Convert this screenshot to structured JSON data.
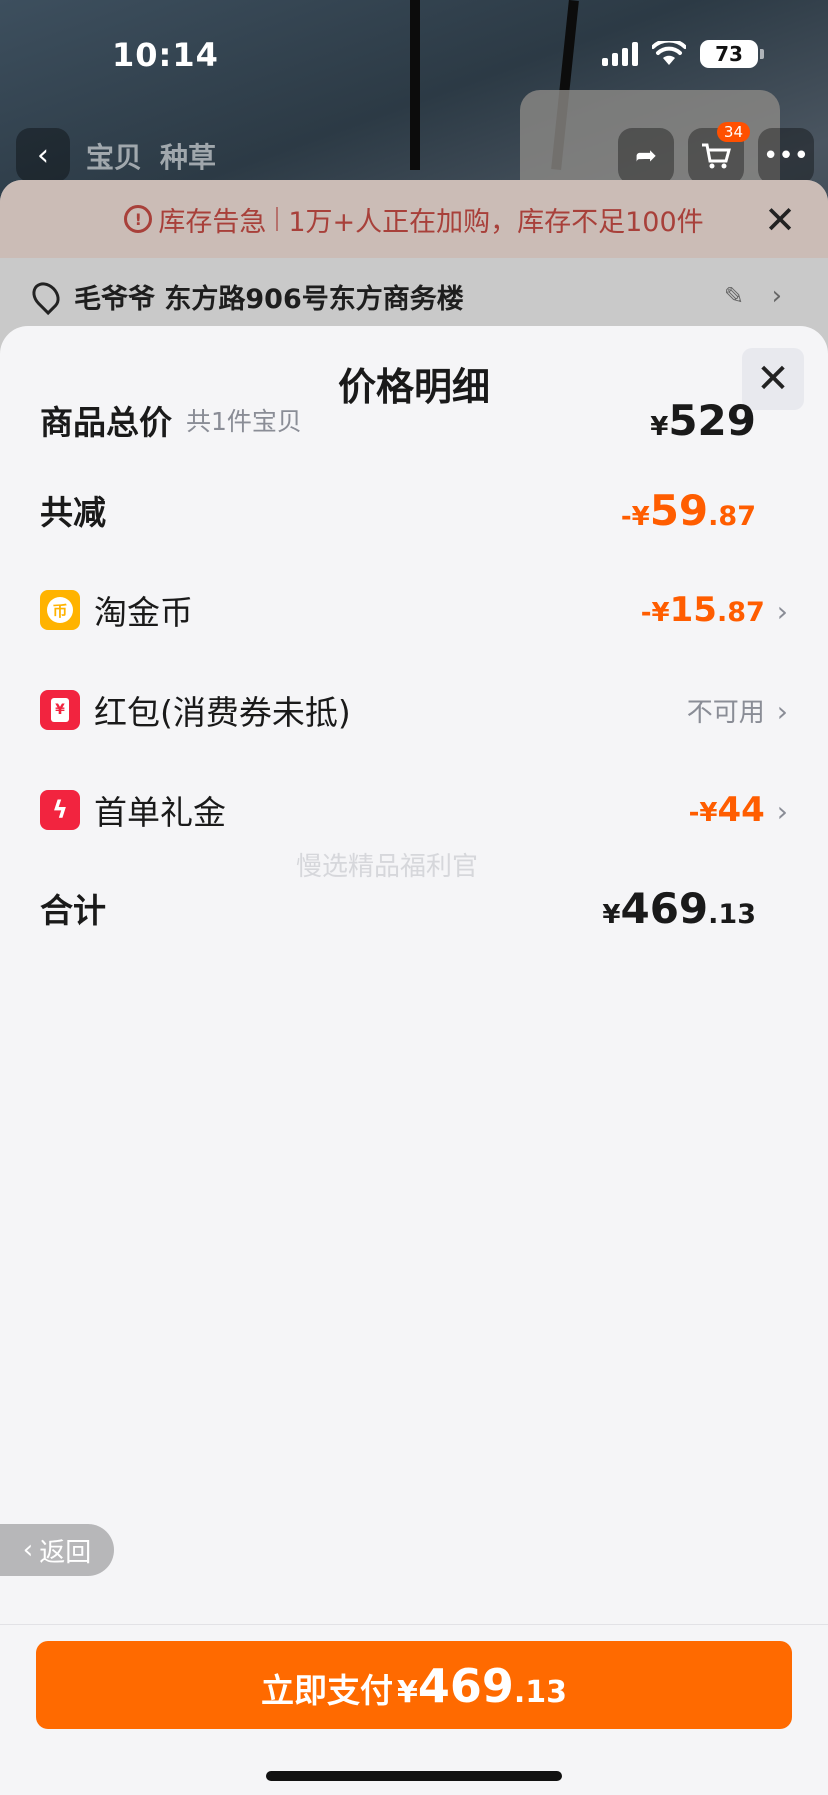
{
  "status_bar": {
    "time": "10:14",
    "battery": "73"
  },
  "nav": {
    "tab_1": "宝贝",
    "tab_2": "种草",
    "cart_count": "34",
    "back_icon": "chevron-left-icon",
    "share_icon": "share-icon",
    "cart_icon": "cart-icon",
    "more_icon": "more-icon"
  },
  "stock_alert": {
    "title": "库存告急",
    "message": "1万+人正在加购，库存不足100件",
    "close_icon": "close-icon"
  },
  "address": {
    "text": "毛爷爷 东方路906号东方商务楼"
  },
  "sheet": {
    "title": "价格明细",
    "close_icon": "close-icon",
    "rows": {
      "total": {
        "label": "商品总价",
        "sub": "共1件宝贝",
        "symbol": "¥",
        "int": "529",
        "dec": ""
      },
      "discount": {
        "label": "共减",
        "symbol": "-¥",
        "int": "59",
        "dec": ".87"
      },
      "coins": {
        "label": "淘金币",
        "icon_text": "币",
        "symbol": "-¥",
        "int": "15",
        "dec": ".87"
      },
      "redpacket": {
        "label": "红包(消费券未抵)",
        "icon_text": "¥",
        "status": "不可用"
      },
      "firstorder": {
        "label": "首单礼金",
        "icon_text": "ϟ",
        "symbol": "-¥",
        "int": "44",
        "dec": ""
      },
      "sum": {
        "label": "合计",
        "symbol": "¥",
        "int": "469",
        "dec": ".13"
      }
    },
    "watermark": "慢选精品福利官"
  },
  "back_pill": {
    "label": "返回"
  },
  "footer": {
    "pay_label": "立即支付",
    "symbol": "¥",
    "int": "469",
    "dec": ".13"
  },
  "colors": {
    "accent": "#ff6a00",
    "discount": "#ff5d00",
    "alert": "#a8403a"
  }
}
